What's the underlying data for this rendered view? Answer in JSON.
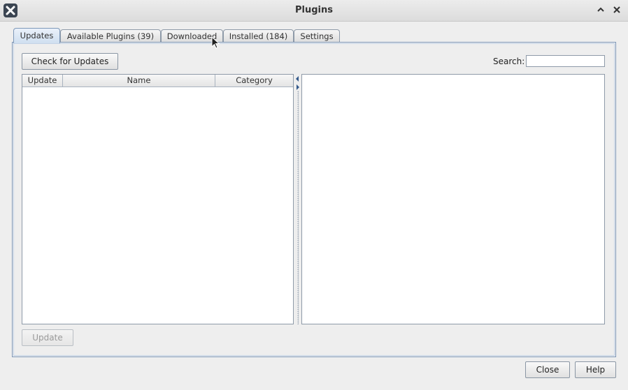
{
  "window": {
    "title": "Plugins",
    "icons": {
      "app": "netbeans-x-icon",
      "minimize": "chevron-up-icon",
      "close": "close-icon"
    }
  },
  "tabs": [
    {
      "label": "Updates",
      "active": true
    },
    {
      "label": "Available Plugins (39)",
      "active": false
    },
    {
      "label": "Downloaded",
      "active": false
    },
    {
      "label": "Installed (184)",
      "active": false
    },
    {
      "label": "Settings",
      "active": false
    }
  ],
  "updates_tab": {
    "check_button": "Check for Updates",
    "search": {
      "label": "Search:",
      "value": "",
      "placeholder": ""
    },
    "table": {
      "columns": [
        "Update",
        "Name",
        "Category"
      ],
      "rows": []
    },
    "update_button": "Update",
    "update_button_enabled": false
  },
  "footer": {
    "close_button": "Close",
    "help_button": "Help"
  },
  "colors": {
    "accent_border": "#7d97b8",
    "active_tab": "#cfdff0",
    "window_bg": "#eeeeee"
  }
}
